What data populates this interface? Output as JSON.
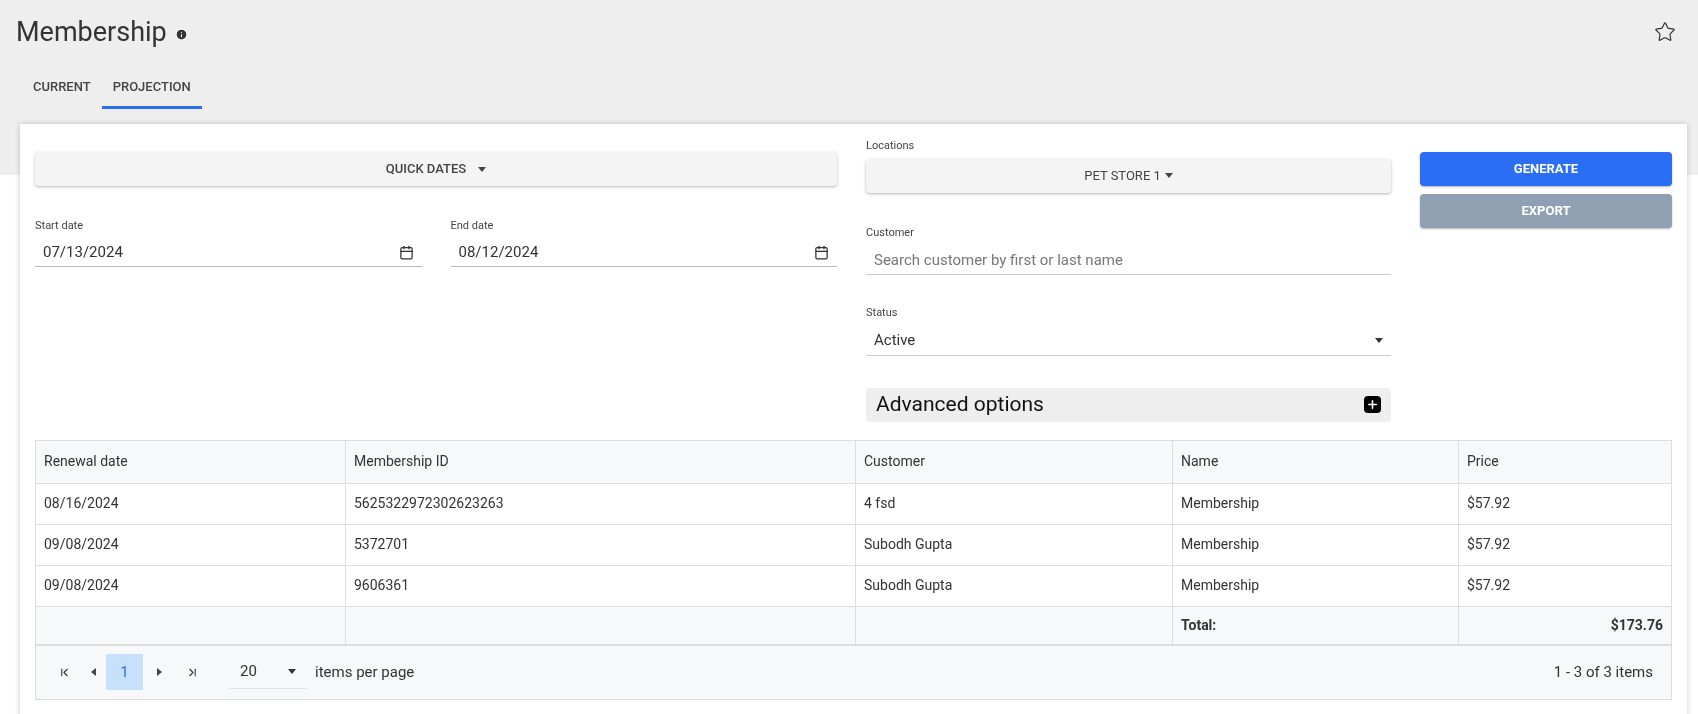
{
  "page": {
    "title": "Membership",
    "favorite": false
  },
  "tabs": [
    {
      "label": "CURRENT",
      "selected": false
    },
    {
      "label": "PROJECTION",
      "selected": true
    }
  ],
  "filters": {
    "quick_dates": "QUICK DATES",
    "start_date": {
      "label": "Start date",
      "value": "07/13/2024"
    },
    "end_date": {
      "label": "End date",
      "value": "08/12/2024"
    },
    "locations": {
      "label": "Locations",
      "value": "PET STORE 1"
    },
    "customer": {
      "label": "Customer",
      "placeholder": "Search customer by first or last name"
    },
    "status": {
      "label": "Status",
      "value": "Active"
    },
    "advanced_options": {
      "label": "Advanced options",
      "expanded": false
    }
  },
  "buttons": [
    {
      "label": "GENERATE",
      "disabled": false
    },
    {
      "label": "EXPORT",
      "disabled": true
    }
  ],
  "table": {
    "columns": [
      "Renewal date",
      "Membership ID",
      "Customer",
      "Name",
      "Price"
    ],
    "rows": [
      [
        "08/16/2024",
        "5625322972302623263",
        "4 fsd",
        "Membership",
        "$57.92"
      ],
      [
        "09/08/2024",
        "5372701",
        "Subodh Gupta",
        "Membership",
        "$57.92"
      ],
      [
        "09/08/2024",
        "9606361",
        "Subodh Gupta",
        "Membership",
        "$57.92"
      ]
    ],
    "total_label": "Total:",
    "total_value": "$173.76"
  },
  "pager": {
    "pages": [
      {
        "label": "1",
        "selected": true
      }
    ],
    "page_size": "20",
    "page_size_label": "items per page",
    "summary": "1 - 3 of 3 items"
  }
}
